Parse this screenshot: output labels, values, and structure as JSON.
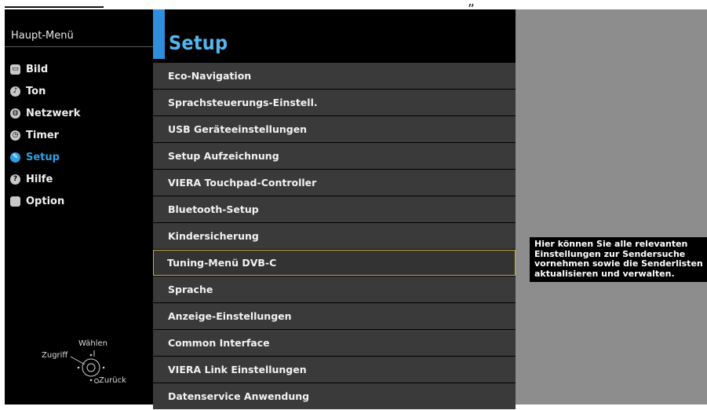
{
  "page_trail": "„",
  "left_menu": {
    "title": "Haupt-Menü",
    "items": [
      {
        "label": "Bild",
        "icon": "picture-icon",
        "active": false
      },
      {
        "label": "Ton",
        "icon": "note-icon",
        "active": false
      },
      {
        "label": "Netzwerk",
        "icon": "globe-icon",
        "active": false
      },
      {
        "label": "Timer",
        "icon": "clock-icon",
        "active": false
      },
      {
        "label": "Setup",
        "icon": "wrench-icon",
        "active": true
      },
      {
        "label": "Hilfe",
        "icon": "question-icon",
        "active": false
      },
      {
        "label": "Option",
        "icon": "square-icon",
        "active": false
      }
    ]
  },
  "nav_hint": {
    "select": "Wählen",
    "access": "Zugriff",
    "back": "Zurück"
  },
  "setup": {
    "title": "Setup",
    "items": [
      "Eco-Navigation",
      "Sprachsteuerungs-Einstell.",
      "USB Geräteeinstellungen",
      "Setup Aufzeichnung",
      "VIERA Touchpad-Controller",
      "Bluetooth-Setup",
      "Kindersicherung",
      "Tuning-Menü DVB-C",
      "Sprache",
      "Anzeige-Einstellungen",
      "Common Interface",
      "VIERA Link Einstellungen",
      "Datenservice Anwendung"
    ],
    "selected_index": 7
  },
  "info": {
    "lines": [
      "Hier können Sie alle relevanten",
      "Einstellungen zur Sendersuche",
      "vornehmen sowie die Senderlisten",
      "aktualisieren und verwalten."
    ]
  },
  "colors": {
    "accent_blue": "#2f8fdc",
    "title_blue": "#54b6f0",
    "selection_gold": "#d4b03a",
    "item_bg": "#3a3a3a",
    "info_panel_bg": "#8d8d8d"
  }
}
